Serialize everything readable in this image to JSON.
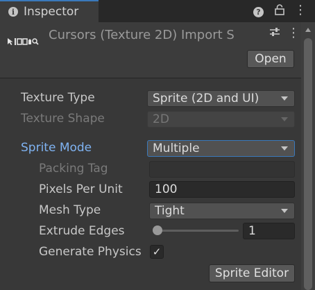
{
  "tab": {
    "title": "Inspector",
    "info_icon": "info-icon",
    "lock_icon": "lock-icon",
    "menu_icon": "kebab-menu-icon",
    "lock_glyph": "⌂",
    "menu_glyph": "⋮"
  },
  "header": {
    "title": "Cursors (Texture 2D) Import S",
    "help_glyph": "?",
    "settings_glyph": "⇅",
    "menu_glyph": "⋮",
    "open_label": "Open"
  },
  "fields": {
    "texture_type": {
      "label": "Texture Type",
      "value": "Sprite (2D and UI)"
    },
    "texture_shape": {
      "label": "Texture Shape",
      "value": "2D"
    },
    "sprite_mode": {
      "label": "Sprite Mode",
      "value": "Multiple"
    },
    "packing_tag": {
      "label": "Packing Tag",
      "value": ""
    },
    "pixels_per_unit": {
      "label": "Pixels Per Unit",
      "value": "100"
    },
    "mesh_type": {
      "label": "Mesh Type",
      "value": "Tight"
    },
    "extrude_edges": {
      "label": "Extrude Edges",
      "value": "1",
      "slider_fraction": 0.03
    },
    "generate_physics": {
      "label": "Generate Physics",
      "checked": true,
      "check_glyph": "✓"
    }
  },
  "buttons": {
    "sprite_editor": "Sprite Editor"
  },
  "colors": {
    "accent": "#3a79bb",
    "active_label": "#7fb3f2",
    "background": "#383838"
  }
}
